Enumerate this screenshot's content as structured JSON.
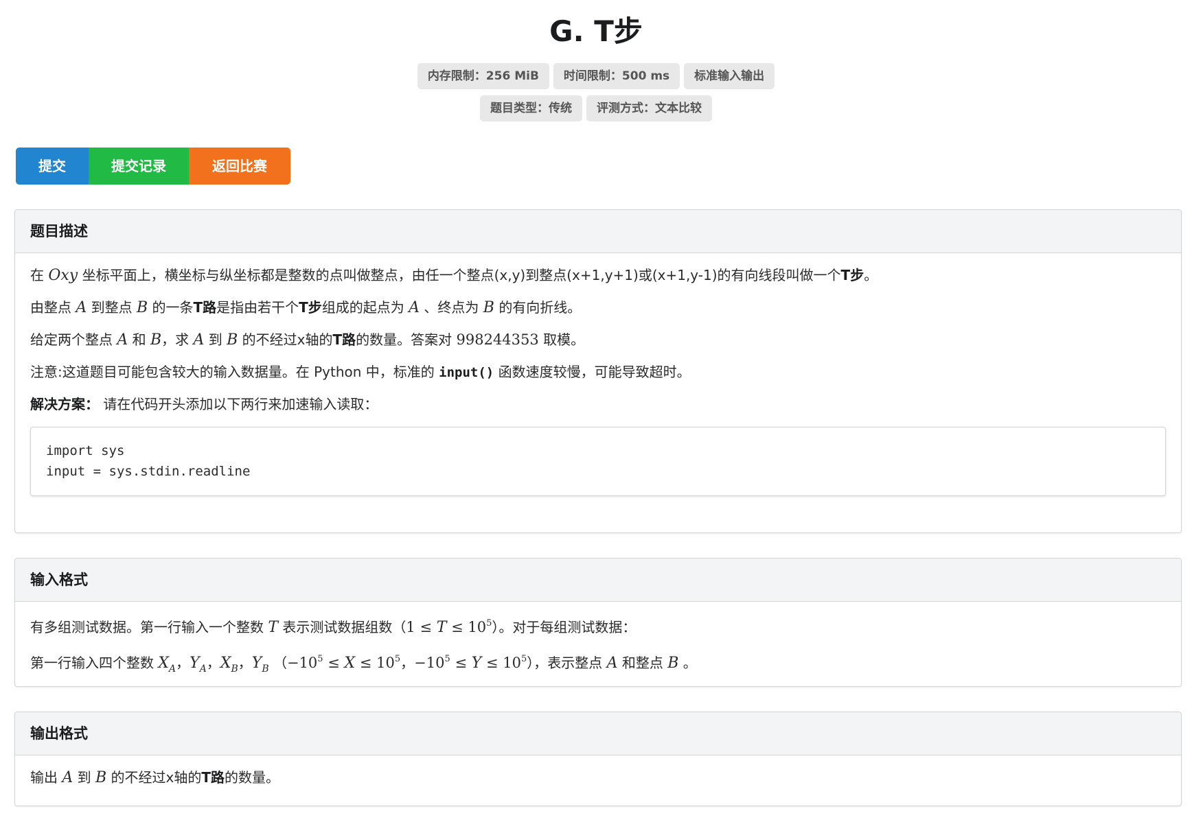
{
  "problem": {
    "title": "G. T步",
    "labels_row1": [
      "内存限制：256 MiB",
      "时间限制：500 ms",
      "标准输入输出"
    ],
    "labels_row2": [
      "题目类型：传统",
      "评测方式：文本比较"
    ]
  },
  "buttons": {
    "submit": "提交",
    "records": "提交记录",
    "back": "返回比赛"
  },
  "description": {
    "header": "题目描述",
    "p1": {
      "a": "在",
      "math1": "Oxy",
      "b": "坐标平面上，横坐标与纵坐标都是整数的点叫做整点，由任一个整点(x,y)到整点(x+1,y+1)或(x+1,y-1)的有向线段叫做一个",
      "bold": "T步",
      "c": "。"
    },
    "p2": {
      "a": "由整点",
      "mA": "A",
      "b": "到整点",
      "mB": "B",
      "c": "的一条",
      "bold1": "T路",
      "d": "是指由若干个",
      "bold2": "T步",
      "e": "组成的起点为",
      "mA2": "A",
      "f": "、终点为",
      "mB2": "B",
      "g": "的有向折线。"
    },
    "p3": {
      "a": "给定两个整点",
      "mA": "A",
      "b": "和",
      "mB": "B",
      "c": "，求",
      "mA2": "A",
      "d": "到",
      "mB2": "B",
      "e": "的不经过x轴的",
      "bold": "T路",
      "f": "的数量。答案对",
      "num": "998244353",
      "g": "取模。"
    },
    "p4": {
      "a": "注意:这道题目可能包含较大的输入数据量。在 Python 中，标准的",
      "code": "input()",
      "b": "函数速度较慢，可能导致超时。"
    },
    "p5": {
      "bold": "解决方案：",
      "a": "请在代码开头添加以下两行来加速输入读取："
    },
    "code_lines": [
      "import sys",
      "input = sys.stdin.readline"
    ]
  },
  "input_format": {
    "header": "输入格式",
    "p1": {
      "a": "有多组测试数据。第一行输入一个整数",
      "mT": "T",
      "b": "表示测试数据组数（",
      "one": "1",
      "le1": " ≤ ",
      "mT2": "T",
      "le2": " ≤ ",
      "ten": "10",
      "exp": "5",
      "c": "）。对于每组测试数据："
    },
    "p2": {
      "a": "第一行输入四个整数",
      "XA": "X",
      "XAs": "A",
      "s1": "，",
      "YA": "Y",
      "YAs": "A",
      "s2": "，",
      "XB": "X",
      "XBs": "B",
      "s3": "，",
      "YB": "Y",
      "YBs": "B",
      "b": "（",
      "neg1": "−10",
      "e1": "5",
      "le1": " ≤ ",
      "mX": "X",
      "le2": " ≤ ",
      "pos1": "10",
      "e2": "5",
      "c": "，",
      "neg2": "−10",
      "e3": "5",
      "le3": " ≤ ",
      "mY": "Y",
      "le4": " ≤ ",
      "pos2": "10",
      "e4": "5",
      "d": "），表示整点",
      "mA": "A",
      "e": "和整点",
      "mB": "B",
      "f": "。"
    }
  },
  "output_format": {
    "header": "输出格式",
    "p1": {
      "a": "输出",
      "mA": "A",
      "b": "到",
      "mB": "B",
      "c": "的不经过x轴的",
      "bold": "T路",
      "d": "的数量。"
    }
  },
  "colors": {
    "submit": "#2185d0",
    "records": "#21ba45",
    "back": "#f2711c"
  }
}
